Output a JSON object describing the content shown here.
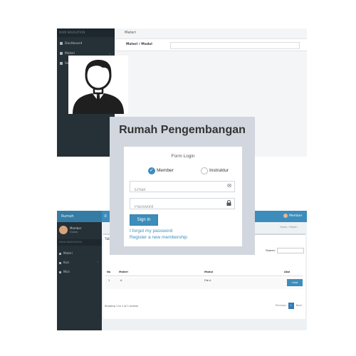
{
  "top_screen": {
    "sidebar_header": "MAIN NAVIGATION",
    "sidebar_items": [
      {
        "label": "Dashboard",
        "has_chevron": false
      },
      {
        "label": "Materi",
        "has_chevron": true
      },
      {
        "label": "Sertifikat",
        "has_chevron": false
      }
    ],
    "breadcrumb": "Materi",
    "field_label": "Materi / Modul"
  },
  "bottom_screen": {
    "logo": "Rumah Pengembangan",
    "user_name": "Member",
    "profile_name": "Member",
    "profile_status": "Online",
    "nav_header": "MAIN NAVIGATION",
    "sidebar_items": [
      {
        "label": "Materi",
        "has_chevron": false
      },
      {
        "label": "Kuis",
        "has_chevron": true
      },
      {
        "label": "Nilai",
        "has_chevron": false
      }
    ],
    "breadcrumb": "Home / Materi",
    "box_title": "Tabel",
    "search_label": "Search:",
    "table_headers": [
      "No",
      "Materi",
      "Modul",
      "Aksi"
    ],
    "table_row": [
      "1",
      "A",
      "File A",
      "Lihat"
    ],
    "info": "Showing 1 to 1 of 1 entries",
    "pager": {
      "prev": "Previous",
      "current": "1",
      "next": "Next"
    }
  },
  "login": {
    "title": "Rumah Pengembangan",
    "form_title": "Form Login",
    "roles": [
      {
        "label": "Member",
        "selected": true
      },
      {
        "label": "Instruktur",
        "selected": false
      }
    ],
    "email_placeholder": "Email",
    "password_placeholder": "Password",
    "email_icon": "envelope-icon",
    "password_icon": "lock-icon",
    "signin_label": "Sign In",
    "forgot_link": "I forgot my password",
    "register_link": "Register a new membership",
    "accent_color": "#3c8dbc"
  }
}
